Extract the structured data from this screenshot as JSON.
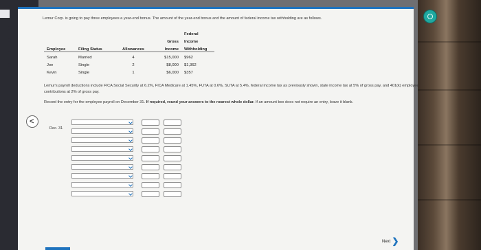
{
  "intro": "Lemur Corp. is going to pay three employees a year-end bonus. The amount of the year-end bonus and the amount of federal income tax withholding are as follows.",
  "table": {
    "header_row1": [
      "",
      "",
      "",
      "",
      "Federal"
    ],
    "header_row2": [
      "",
      "",
      "",
      "Gross",
      "Income"
    ],
    "header_row3": [
      "Employee",
      "Filing Status",
      "Allowances",
      "Income",
      "Withholding"
    ],
    "rows": [
      {
        "employee": "Sarah",
        "status": "Married",
        "allowances": "4",
        "gross": "$15,000",
        "fit": "$962"
      },
      {
        "employee": "Joe",
        "status": "Single",
        "allowances": "2",
        "gross": "$8,000",
        "fit": "$1,362"
      },
      {
        "employee": "Kevin",
        "status": "Single",
        "allowances": "1",
        "gross": "$6,000",
        "fit": "$357"
      }
    ]
  },
  "note": "Lemur's payroll deductions include FICA Social Security at 6.2%, FICA Medicare at 1.45%, FUTA at 0.6%, SUTA at 5.4%, federal income tax as previously shown, state income tax at 5% of gross pay, and 401(k) employee contributions at 2% of gross pay.",
  "instruction_prefix": "Record the entry for the employee payroll on December 31.",
  "instruction_bold": "If required, round your answers to the nearest whole dollar.",
  "instruction_suffix": "If an amount box does not require an entry, leave it blank.",
  "journal": {
    "date_label": "Dec. 31",
    "rows": [
      {
        "account": "",
        "debit": "",
        "credit": ""
      },
      {
        "account": "",
        "debit": "",
        "credit": ""
      },
      {
        "account": "",
        "debit": "",
        "credit": ""
      },
      {
        "account": "",
        "debit": "",
        "credit": ""
      },
      {
        "account": "",
        "debit": "",
        "credit": ""
      },
      {
        "account": "",
        "debit": "",
        "credit": ""
      },
      {
        "account": "",
        "debit": "",
        "credit": ""
      },
      {
        "account": "",
        "debit": "",
        "credit": ""
      },
      {
        "account": "",
        "debit": "",
        "credit": ""
      }
    ]
  },
  "nav": {
    "back_symbol": "<",
    "next_label": "Next",
    "next_symbol": "❯"
  },
  "colors": {
    "accent": "#1e73be",
    "page": "#f4f4f2",
    "sidebar": "#2a2b32"
  }
}
